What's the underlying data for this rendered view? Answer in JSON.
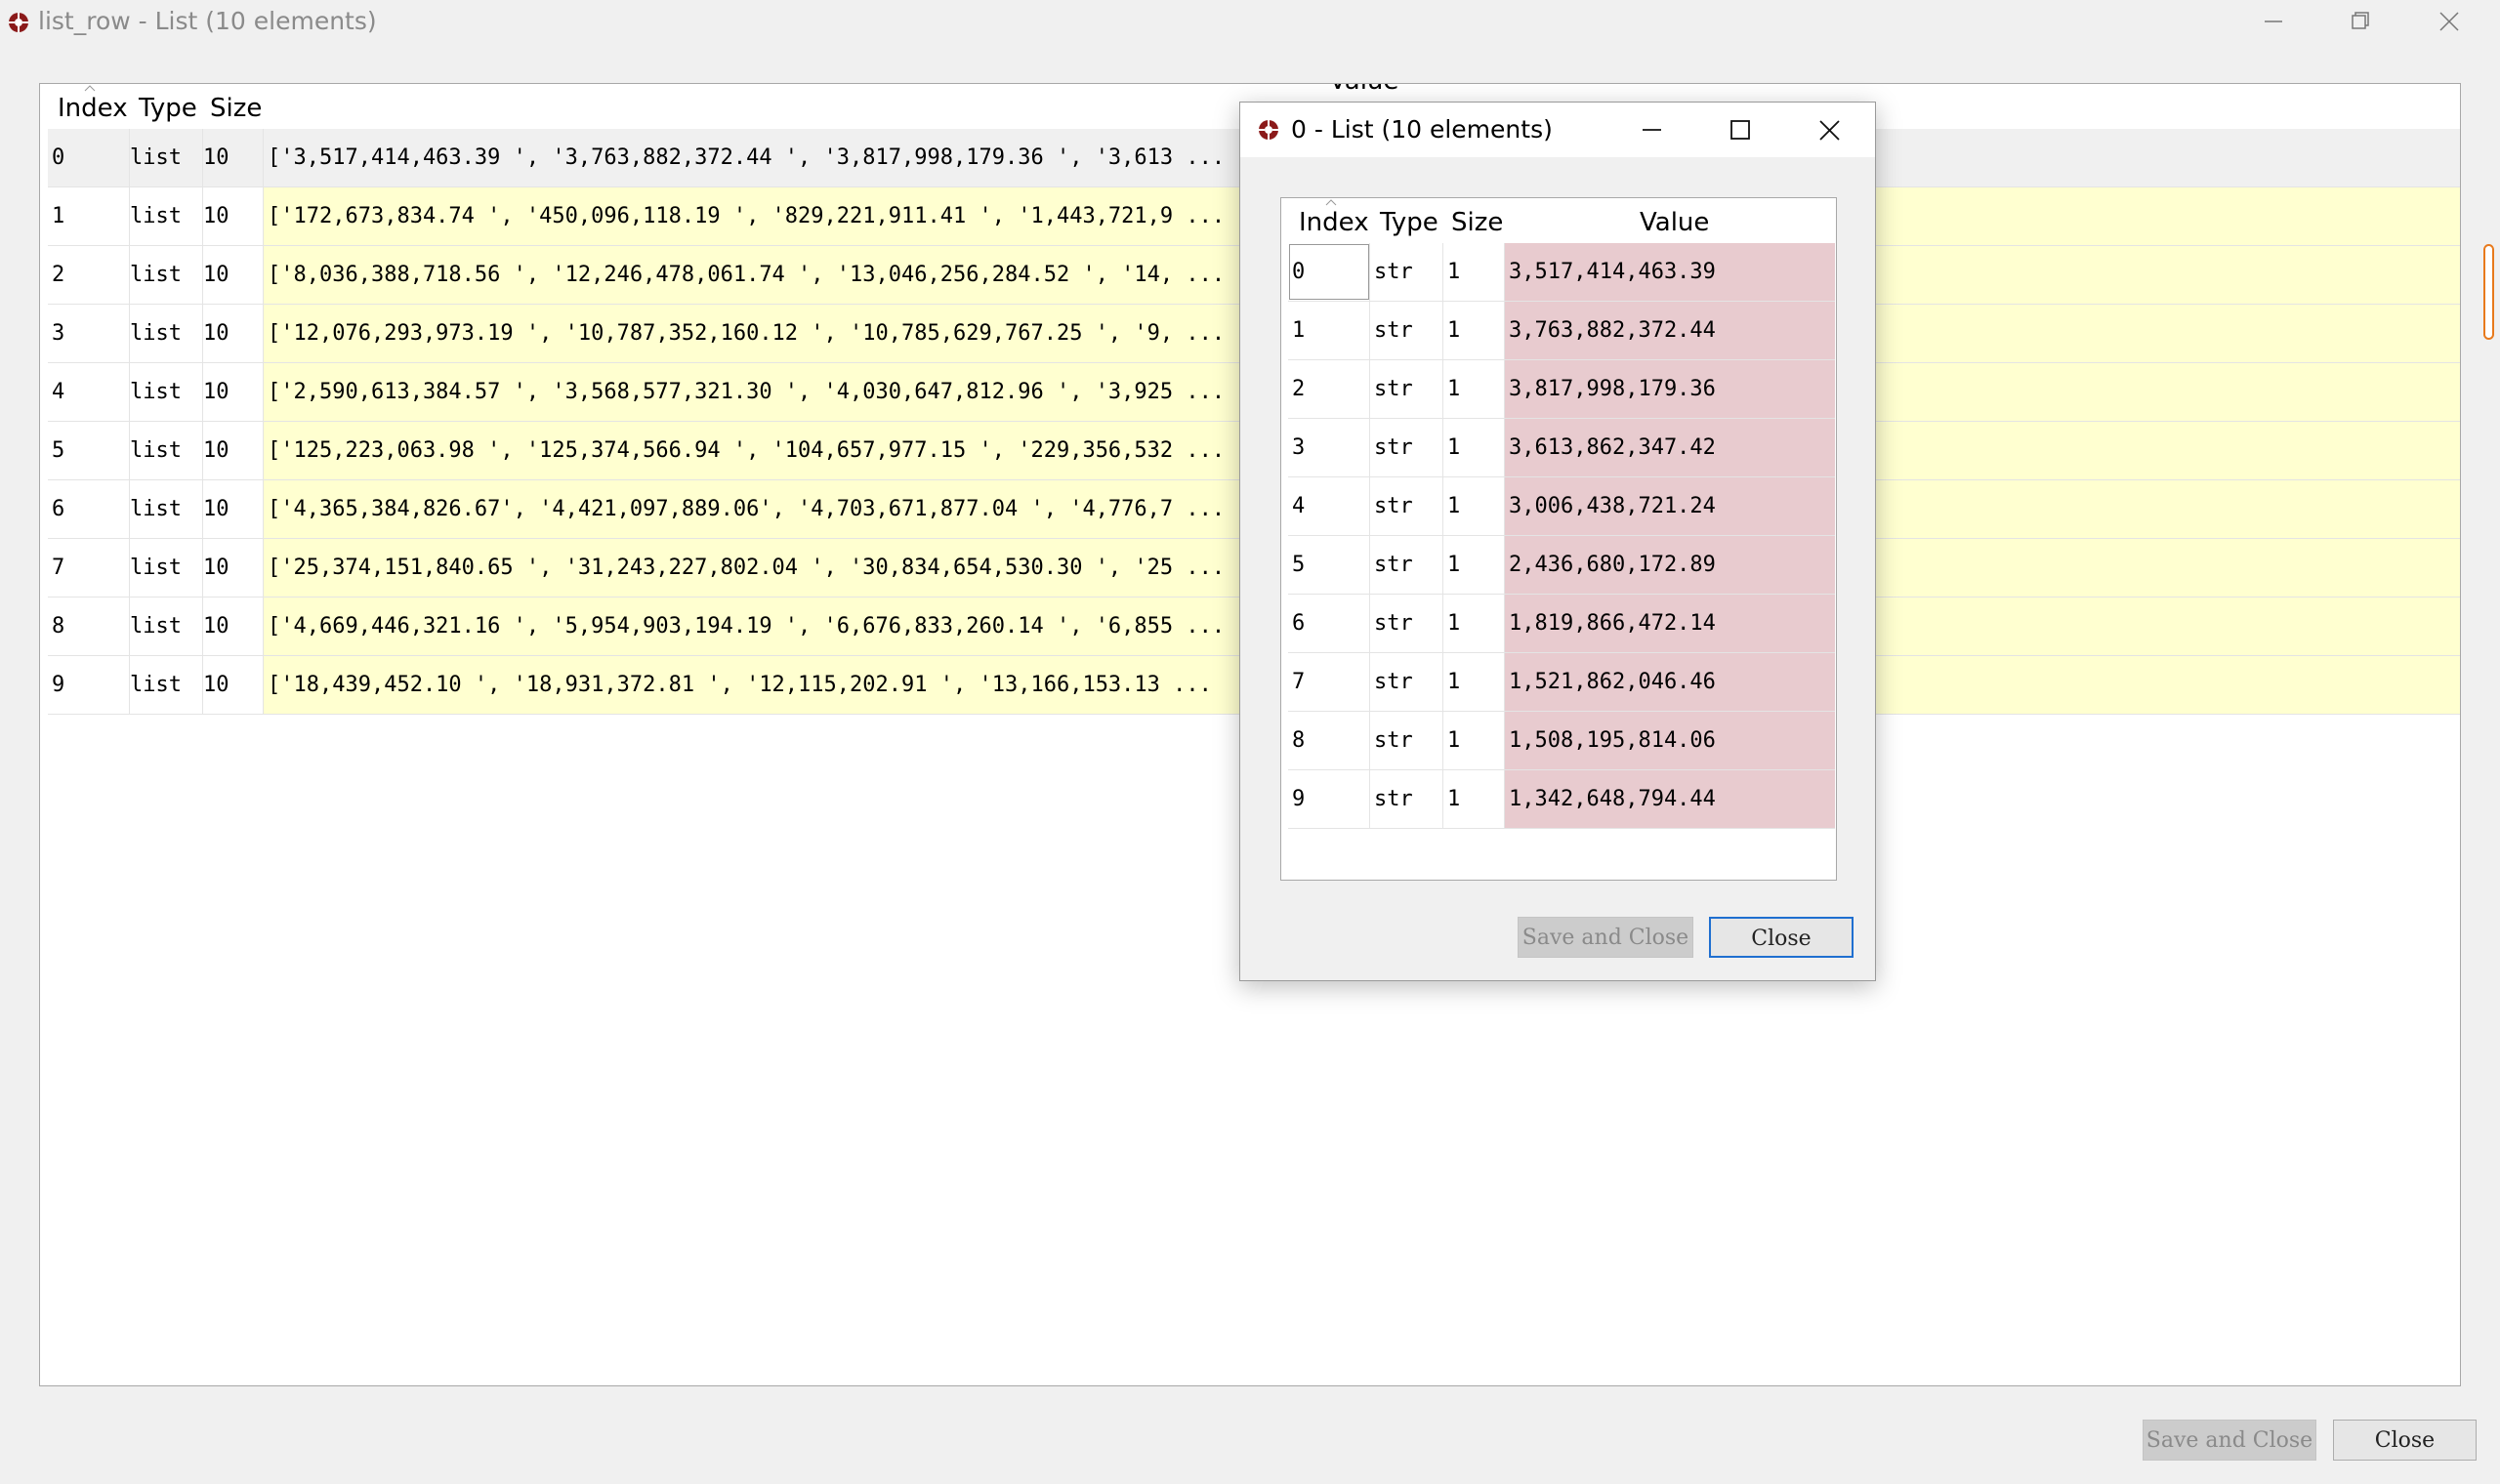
{
  "window": {
    "title": "list_row - List (10 elements)",
    "icon": "spyder-icon"
  },
  "main_table": {
    "columns": [
      "Index",
      "Type",
      "Size",
      "Value"
    ],
    "rows": [
      {
        "index": "0",
        "type": "list",
        "size": "10",
        "value": "['3,517,414,463.39 ', '3,763,882,372.44 ', '3,817,998,179.36 ', '3,613 ..."
      },
      {
        "index": "1",
        "type": "list",
        "size": "10",
        "value": "['172,673,834.74 ', '450,096,118.19 ', '829,221,911.41 ', '1,443,721,9 ..."
      },
      {
        "index": "2",
        "type": "list",
        "size": "10",
        "value": "['8,036,388,718.56 ', '12,246,478,061.74 ', '13,046,256,284.52 ', '14, ..."
      },
      {
        "index": "3",
        "type": "list",
        "size": "10",
        "value": "['12,076,293,973.19 ', '10,787,352,160.12 ', '10,785,629,767.25 ', '9, ..."
      },
      {
        "index": "4",
        "type": "list",
        "size": "10",
        "value": "['2,590,613,384.57 ', '3,568,577,321.30 ', '4,030,647,812.96 ', '3,925 ..."
      },
      {
        "index": "5",
        "type": "list",
        "size": "10",
        "value": "['125,223,063.98 ', '125,374,566.94 ', '104,657,977.15 ', '229,356,532 ..."
      },
      {
        "index": "6",
        "type": "list",
        "size": "10",
        "value": "['4,365,384,826.67', '4,421,097,889.06', '4,703,671,877.04 ', '4,776,7 ..."
      },
      {
        "index": "7",
        "type": "list",
        "size": "10",
        "value": "['25,374,151,840.65 ', '31,243,227,802.04 ', '30,834,654,530.30 ', '25 ..."
      },
      {
        "index": "8",
        "type": "list",
        "size": "10",
        "value": "['4,669,446,321.16 ', '5,954,903,194.19 ', '6,676,833,260.14 ', '6,855 ..."
      },
      {
        "index": "9",
        "type": "list",
        "size": "10",
        "value": "['18,439,452.10 ', '18,931,372.81 ', '12,115,202.91 ', '13,166,153.13 ..."
      }
    ]
  },
  "main_buttons": {
    "save_close": "Save and Close",
    "close": "Close"
  },
  "dialog": {
    "title": "0 - List (10 elements)",
    "columns": [
      "Index",
      "Type",
      "Size",
      "Value"
    ],
    "rows": [
      {
        "index": "0",
        "type": "str",
        "size": "1",
        "value": "3,517,414,463.39"
      },
      {
        "index": "1",
        "type": "str",
        "size": "1",
        "value": "3,763,882,372.44"
      },
      {
        "index": "2",
        "type": "str",
        "size": "1",
        "value": "3,817,998,179.36"
      },
      {
        "index": "3",
        "type": "str",
        "size": "1",
        "value": "3,613,862,347.42"
      },
      {
        "index": "4",
        "type": "str",
        "size": "1",
        "value": "3,006,438,721.24"
      },
      {
        "index": "5",
        "type": "str",
        "size": "1",
        "value": "2,436,680,172.89"
      },
      {
        "index": "6",
        "type": "str",
        "size": "1",
        "value": "1,819,866,472.14"
      },
      {
        "index": "7",
        "type": "str",
        "size": "1",
        "value": "1,521,862,046.46"
      },
      {
        "index": "8",
        "type": "str",
        "size": "1",
        "value": "1,508,195,814.06"
      },
      {
        "index": "9",
        "type": "str",
        "size": "1",
        "value": "1,342,648,794.44"
      }
    ],
    "buttons": {
      "save_close": "Save and Close",
      "close": "Close"
    }
  },
  "colors": {
    "highlight_yellow": "#ffffd0",
    "value_pink": "#e8cbcf",
    "scroll_accent": "#e87a1c",
    "focus_blue": "#1f6fd0"
  }
}
